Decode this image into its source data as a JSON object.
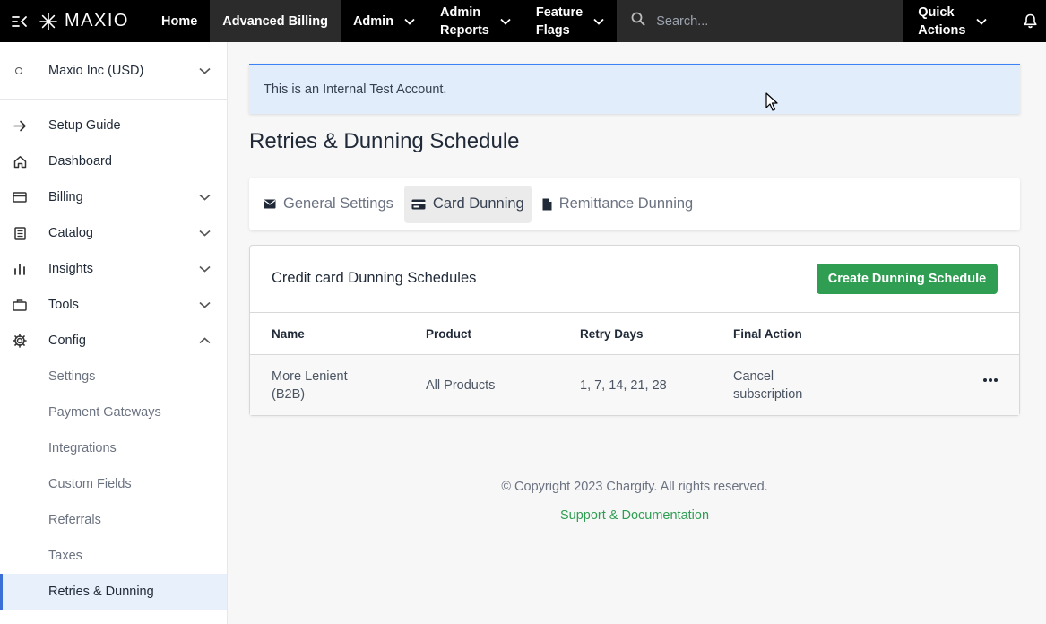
{
  "topbar": {
    "logo": "MAXIO",
    "nav": [
      {
        "label": "Home",
        "has_menu": false
      },
      {
        "label": "Advanced Billing",
        "has_menu": false,
        "active": true
      },
      {
        "label": "Admin",
        "has_menu": true
      },
      {
        "label1": "Admin",
        "label2": "Reports",
        "has_menu": true
      },
      {
        "label1": "Feature",
        "label2": "Flags",
        "has_menu": true
      }
    ],
    "search_placeholder": "Search...",
    "quick_actions_1": "Quick",
    "quick_actions_2": "Actions"
  },
  "sidebar": {
    "account": "Maxio Inc (USD)",
    "items": [
      {
        "label": "Setup Guide",
        "icon": "arrow-right-icon"
      },
      {
        "label": "Dashboard",
        "icon": "home-icon"
      },
      {
        "label": "Billing",
        "icon": "billing-icon",
        "expandable": true
      },
      {
        "label": "Catalog",
        "icon": "catalog-icon",
        "expandable": true
      },
      {
        "label": "Insights",
        "icon": "chart-icon",
        "expandable": true
      },
      {
        "label": "Tools",
        "icon": "briefcase-icon",
        "expandable": true
      },
      {
        "label": "Config",
        "icon": "gear-icon",
        "expandable": true,
        "expanded": true
      }
    ],
    "config_items": [
      {
        "label": "Settings"
      },
      {
        "label": "Payment Gateways"
      },
      {
        "label": "Integrations"
      },
      {
        "label": "Custom Fields"
      },
      {
        "label": "Referrals"
      },
      {
        "label": "Taxes"
      },
      {
        "label": "Retries & Dunning",
        "selected": true
      }
    ]
  },
  "banner": "This is an Internal Test Account.",
  "page_title": "Retries & Dunning Schedule",
  "tabs": [
    {
      "label": "General Settings",
      "icon": "envelope-icon"
    },
    {
      "label": "Card Dunning",
      "icon": "credit-card-icon",
      "active": true
    },
    {
      "label": "Remittance Dunning",
      "icon": "document-icon"
    }
  ],
  "card": {
    "title": "Credit card Dunning Schedules",
    "create_button": "Create Dunning Schedule",
    "columns": [
      "Name",
      "Product",
      "Retry Days",
      "Final Action"
    ],
    "rows": [
      {
        "name_1": "More Lenient",
        "name_2": "(B2B)",
        "product": "All Products",
        "retry_days": "1, 7, 14, 21, 28",
        "final_action_1": "Cancel",
        "final_action_2": "subscription"
      }
    ]
  },
  "footer": {
    "copyright": "© Copyright 2023 Chargify. All rights reserved.",
    "link": "Support & Documentation"
  },
  "colors": {
    "accent_green": "#2f9e53",
    "banner_blue": "#e1edfb",
    "topbar": "#000000"
  }
}
